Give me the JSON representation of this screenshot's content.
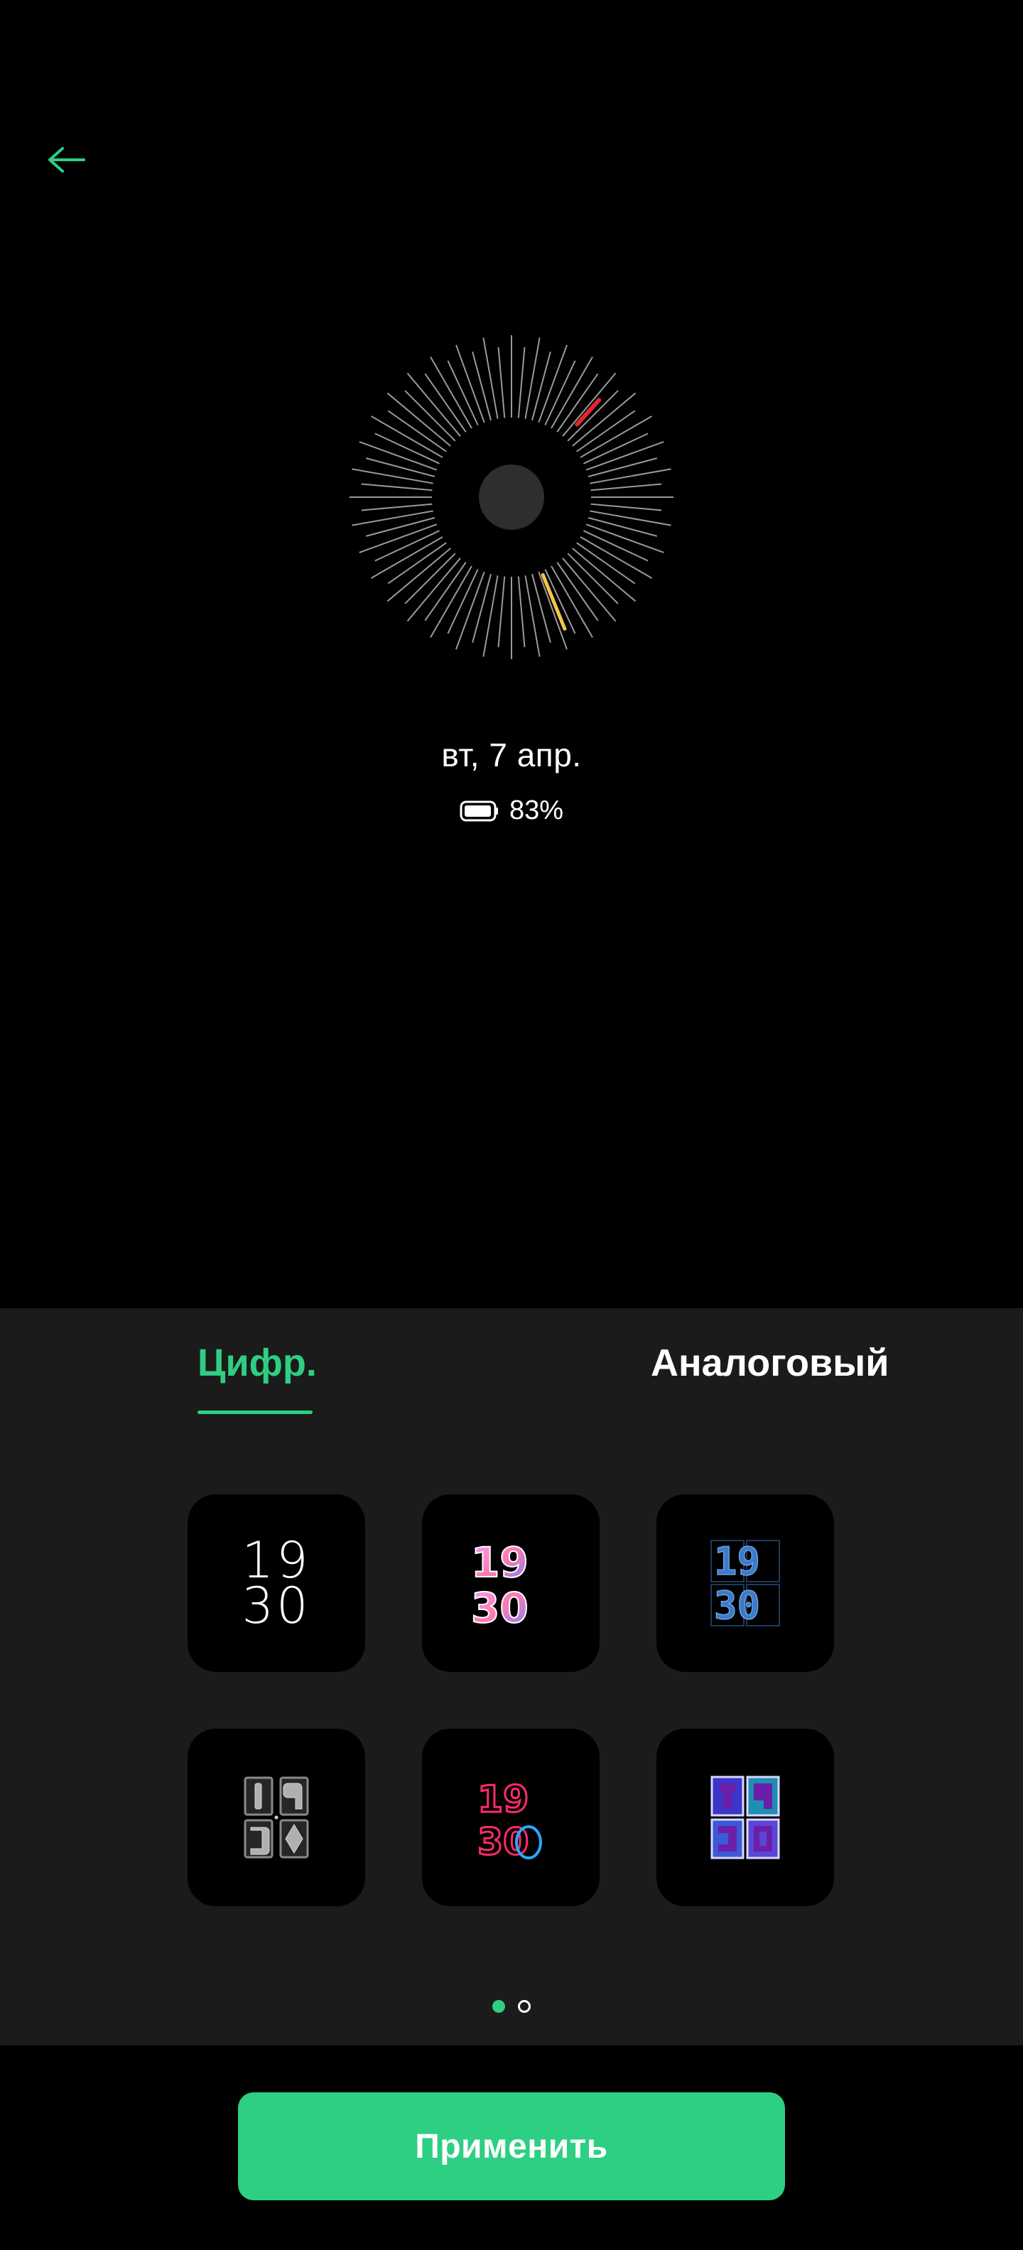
{
  "header": {
    "back_icon": "arrow-left-icon"
  },
  "preview": {
    "date": "вт, 7 апр.",
    "battery_icon": "battery-icon",
    "battery_percent": "83%"
  },
  "tabs": [
    {
      "label": "Цифр.",
      "active": true
    },
    {
      "label": "Аналоговый",
      "active": false
    }
  ],
  "styles": [
    {
      "name": "plain",
      "top": "19",
      "bottom": "30"
    },
    {
      "name": "isometric-colorful",
      "top": "19",
      "bottom": "30"
    },
    {
      "name": "blue-grid",
      "top": "19",
      "bottom": "30"
    },
    {
      "name": "gray-ornate",
      "top": "19",
      "bottom": "30"
    },
    {
      "name": "neon",
      "top": "19",
      "bottom": "30"
    },
    {
      "name": "purple-blocks",
      "top": "19",
      "bottom": "30"
    }
  ],
  "pagination": {
    "current": 1,
    "total": 2
  },
  "apply_button": {
    "label": "Применить"
  },
  "colors": {
    "accent": "#2dcf82",
    "panel": "#1b1b1b",
    "background": "#000000"
  }
}
